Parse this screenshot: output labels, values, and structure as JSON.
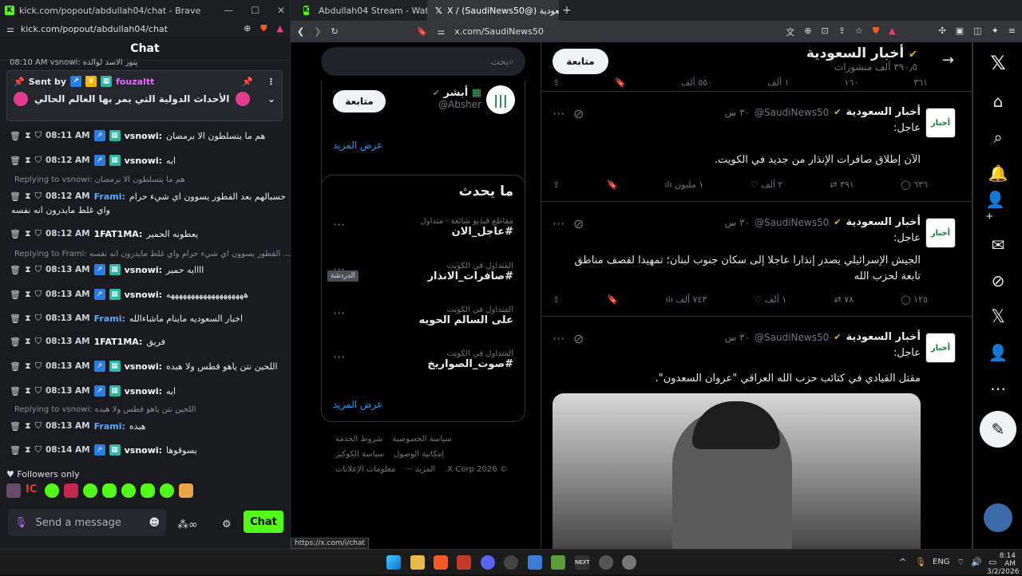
{
  "kick": {
    "window_title": "kick.com/popout/abdullah04/chat - Brave",
    "url": "kick.com/popout/abdullah04/chat",
    "chat_title": "Chat",
    "top_cut": "08:10 AM vsnowi: ينور الاسد لوالده",
    "pinned": {
      "sent_by_label": "Sent by",
      "user": "fouzaltt",
      "text": "الأحداث الدولية التي يمر بها العالم الحالي"
    },
    "messages": [
      {
        "time": "08:11 AM",
        "user": "vsnowi:",
        "text": "هم ما يتسلطون الا برمضان",
        "color": "#ffffff",
        "badges": true
      },
      {
        "time": "08:12 AM",
        "user": "vsnowi:",
        "text": "ايه",
        "color": "#ffffff",
        "badges": true
      },
      {
        "reply": "Replying to vsnowi: هم ما يتسلطون الا برمضان"
      },
      {
        "time": "08:12 AM",
        "user": "Frami:",
        "text": "حسبالهم بعد الفطور يسوون اي شيء حرام",
        "text2": "واي غلط مايدرون انه نفسه",
        "color": "#5aa9ff",
        "badges": false
      },
      {
        "time": "08:12 AM",
        "user": "1FAT1MA:",
        "text": "يعطونه الحمير",
        "color": "#ffffff",
        "badges": false
      },
      {
        "reply": "Replying to Frami: القطور يسوون اي شيء حرام واي غلط مايدرون انه نفسه ..."
      },
      {
        "time": "08:13 AM",
        "user": "vsnowi:",
        "text": "اااايه حمير",
        "color": "#ffffff",
        "badges": true
      },
      {
        "time": "08:13 AM",
        "user": "vsnowi:",
        "text": "هههههههههههههههههههه",
        "color": "#ffffff",
        "badges": true
      },
      {
        "time": "08:13 AM",
        "user": "Frami:",
        "text": "اخبار السعوديه ماينام ماشاءالله",
        "color": "#5aa9ff",
        "badges": false
      },
      {
        "time": "08:13 AM",
        "user": "1FAT1MA:",
        "text": "فريق",
        "color": "#ffffff",
        "badges": false
      },
      {
        "time": "08:13 AM",
        "user": "vsnowi:",
        "text": "اللحين نتن ياهو قطس ولا هبده",
        "color": "#ffffff",
        "badges": true
      },
      {
        "time": "08:13 AM",
        "user": "vsnowi:",
        "text": "ايه",
        "color": "#ffffff",
        "badges": true
      },
      {
        "reply": "Replying to vsnowi: اللحين نتن ياهو قطس ولا هبده"
      },
      {
        "time": "08:13 AM",
        "user": "Frami:",
        "text": "هبده",
        "color": "#5aa9ff",
        "badges": false
      },
      {
        "time": "08:14 AM",
        "user": "vsnowi:",
        "text": "يسوقوها",
        "color": "#ffffff",
        "badges": true
      }
    ],
    "followers_only": "Followers only",
    "input_placeholder": "Send a message",
    "chat_button": "Chat"
  },
  "browser": {
    "tab1": "Abdullah04 Stream - Watch Live on K",
    "tab2": "أخبار السعودية (@SaudiNews50) / X",
    "url": "x.com/SaudiNews50",
    "status_url": "https://x.com/i/chat"
  },
  "x": {
    "profile_name": "أخبار السعودية",
    "posts_count": "٣٩٠٫٥ ألف منشورات",
    "follow": "متابعة",
    "top_actions": [
      "٣٦١",
      "١٦٠",
      "١ ألف",
      "٥٥٠ ألف"
    ],
    "tweets": [
      {
        "name": "أخبار السعودية",
        "handle": "@SaudiNews50",
        "time": "٣٠ س",
        "label": "عاجل:",
        "body": "الآن إطلاق صافرات الإنذار من جديد في الكويت.",
        "actions": [
          "٦٣٦",
          "٣٩١",
          "٢ ألف",
          "١ مليون"
        ]
      },
      {
        "name": "أخبار السعودية",
        "handle": "@SaudiNews50",
        "time": "٣٠ س",
        "label": "عاجل:",
        "body": "الجيش الإسرائيلي يصدر إنذارا عاجلا إلى سكان جنوب لبنان؛ تمهيدا لقصف مناطق تابعة لحزب الله",
        "actions": [
          "١٢٥",
          "٧٨",
          "١ ألف",
          "٧٤٣ ألف"
        ]
      },
      {
        "name": "أخبار السعودية",
        "handle": "@SaudiNews50",
        "time": "٣٠ س",
        "label": "عاجل:",
        "body": "مقتل القيادي في كتائب حزب الله العراقي \"عروان السعدون\"."
      }
    ],
    "suggest": {
      "name": "أبشر",
      "handle": "@Absher",
      "follow": "متابعة",
      "more": "عرض المزيد"
    },
    "whats_happening": "ما يحدث",
    "trends": [
      {
        "meta": "مقاطع فيديو شائعة · متداول",
        "title": "#عاجل_الان"
      },
      {
        "meta": "المتداول في الكويت",
        "title": "#صافرات_الانذار"
      },
      {
        "meta": "المتداول في الكويت",
        "title": "على السالم الحويه"
      },
      {
        "meta": "المتداول في الكويت",
        "title": "#صوت_الصواريخ"
      }
    ],
    "trends_more": "عرض المزيد",
    "tooltip": "الدردشة",
    "footer": [
      "شروط الخدمة",
      "سياسة الخصوصية",
      "سياسة الكوكيز",
      "إمكانية الوصول",
      "معلومات الإعلانات",
      "المزيد ···",
      "© 2026 X Corp."
    ]
  },
  "taskbar": {
    "lang": "ENG",
    "time": "8:14 AM",
    "date": "3/2/2026"
  }
}
